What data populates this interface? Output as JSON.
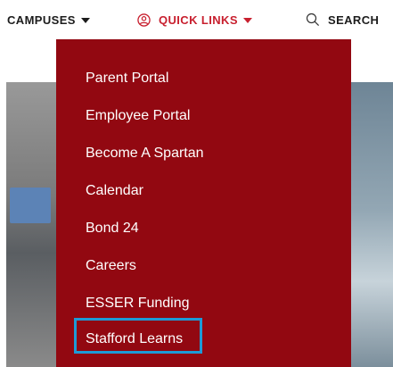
{
  "nav": {
    "campuses_label": "CAMPUSES",
    "quick_links_label": "QUICK LINKS",
    "search_label": "SEARCH"
  },
  "colors": {
    "accent_red": "#c8202f",
    "dropdown_bg": "#920811",
    "highlight_blue": "#1e9ad6"
  },
  "icons": {
    "quick_links": "user-circle-icon",
    "search": "search-icon",
    "caret": "caret-down-icon"
  },
  "quick_links_menu": {
    "items": [
      "Parent Portal",
      "Employee Portal",
      "Become A Spartan",
      "Calendar",
      "Bond 24",
      "Careers",
      "ESSER Funding",
      "Stafford Learns"
    ],
    "highlighted_item": "Stafford Learns"
  }
}
